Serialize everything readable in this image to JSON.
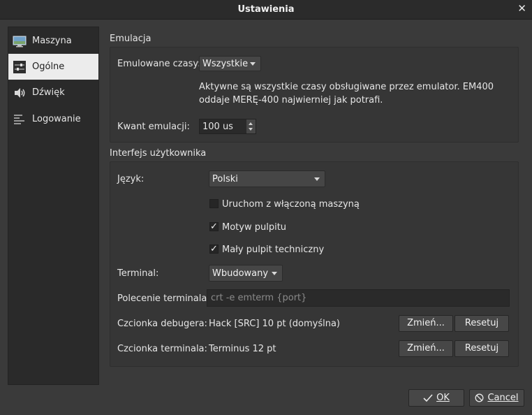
{
  "window": {
    "title": "Ustawienia",
    "close_symbol": "✕"
  },
  "sidebar": {
    "items": [
      {
        "label": "Maszyna",
        "icon": "monitor-icon"
      },
      {
        "label": "Ogólne",
        "icon": "sliders-icon",
        "active": true
      },
      {
        "label": "Dźwięk",
        "icon": "speaker-icon"
      },
      {
        "label": "Logowanie",
        "icon": "log-lines-icon"
      }
    ]
  },
  "emulation": {
    "group_title": "Emulacja",
    "timers_label": "Emulowane czasy:",
    "timers_value": "Wszystkie",
    "info": "Aktywne są wszystkie czasy obsługiwane przez emulator. EM400 oddaje MERĘ-400 najwierniej jak potrafi.",
    "quantum_label": "Kwant emulacji:",
    "quantum_value": "100 us"
  },
  "ui": {
    "group_title": "Interfejs użytkownika",
    "language_label": "Język:",
    "language_value": "Polski",
    "checkboxes": [
      {
        "label": "Uruchom z włączoną maszyną",
        "checked": false
      },
      {
        "label": "Motyw pulpitu",
        "checked": true
      },
      {
        "label": "Mały pulpit techniczny",
        "checked": true
      }
    ],
    "check_mark": "✓",
    "terminal_label": "Terminal:",
    "terminal_value": "Wbudowany",
    "terminal_cmd_label": "Polecenie terminala:",
    "terminal_cmd_placeholder": "crt -e emterm {port}",
    "debug_font_label": "Czcionka debugera:",
    "debug_font_value": "Hack [SRC] 10 pt (domyślna)",
    "terminal_font_label": "Czcionka terminala:",
    "terminal_font_value": "Terminus 12 pt",
    "change_label": "Zmień...",
    "reset_label": "Resetuj"
  },
  "footer": {
    "ok_label": "OK",
    "cancel_label": "Cancel"
  }
}
